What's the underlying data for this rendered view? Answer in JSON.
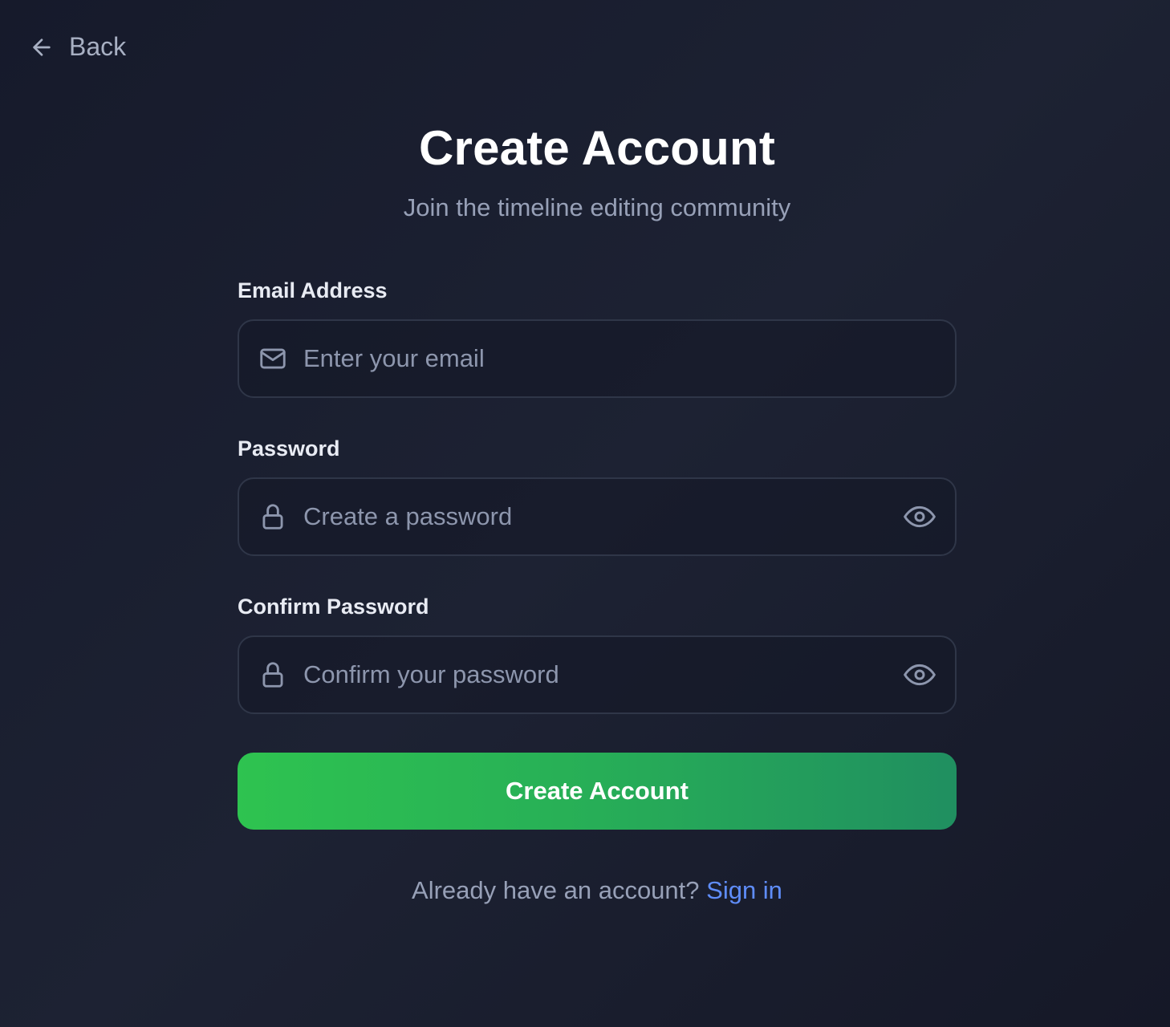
{
  "nav": {
    "back_label": "Back",
    "back_icon": "arrow-left-icon"
  },
  "header": {
    "title": "Create Account",
    "subtitle": "Join the timeline editing community"
  },
  "form": {
    "email": {
      "label": "Email Address",
      "placeholder": "Enter your email",
      "value": "",
      "icon": "mail-icon"
    },
    "password": {
      "label": "Password",
      "placeholder": "Create a password",
      "value": "",
      "icon": "lock-icon",
      "toggle_icon": "eye-icon"
    },
    "confirm_password": {
      "label": "Confirm Password",
      "placeholder": "Confirm your password",
      "value": "",
      "icon": "lock-icon",
      "toggle_icon": "eye-icon"
    },
    "submit_label": "Create Account"
  },
  "footer": {
    "prompt": "Already have an account?",
    "link_label": "Sign in"
  },
  "colors": {
    "background": "#1a1e2e",
    "accent_green_start": "#2ec350",
    "accent_green_end": "#208f60",
    "link_blue": "#5f8dfa",
    "muted_text": "#97a0b7",
    "field_border": "#2f3648"
  }
}
